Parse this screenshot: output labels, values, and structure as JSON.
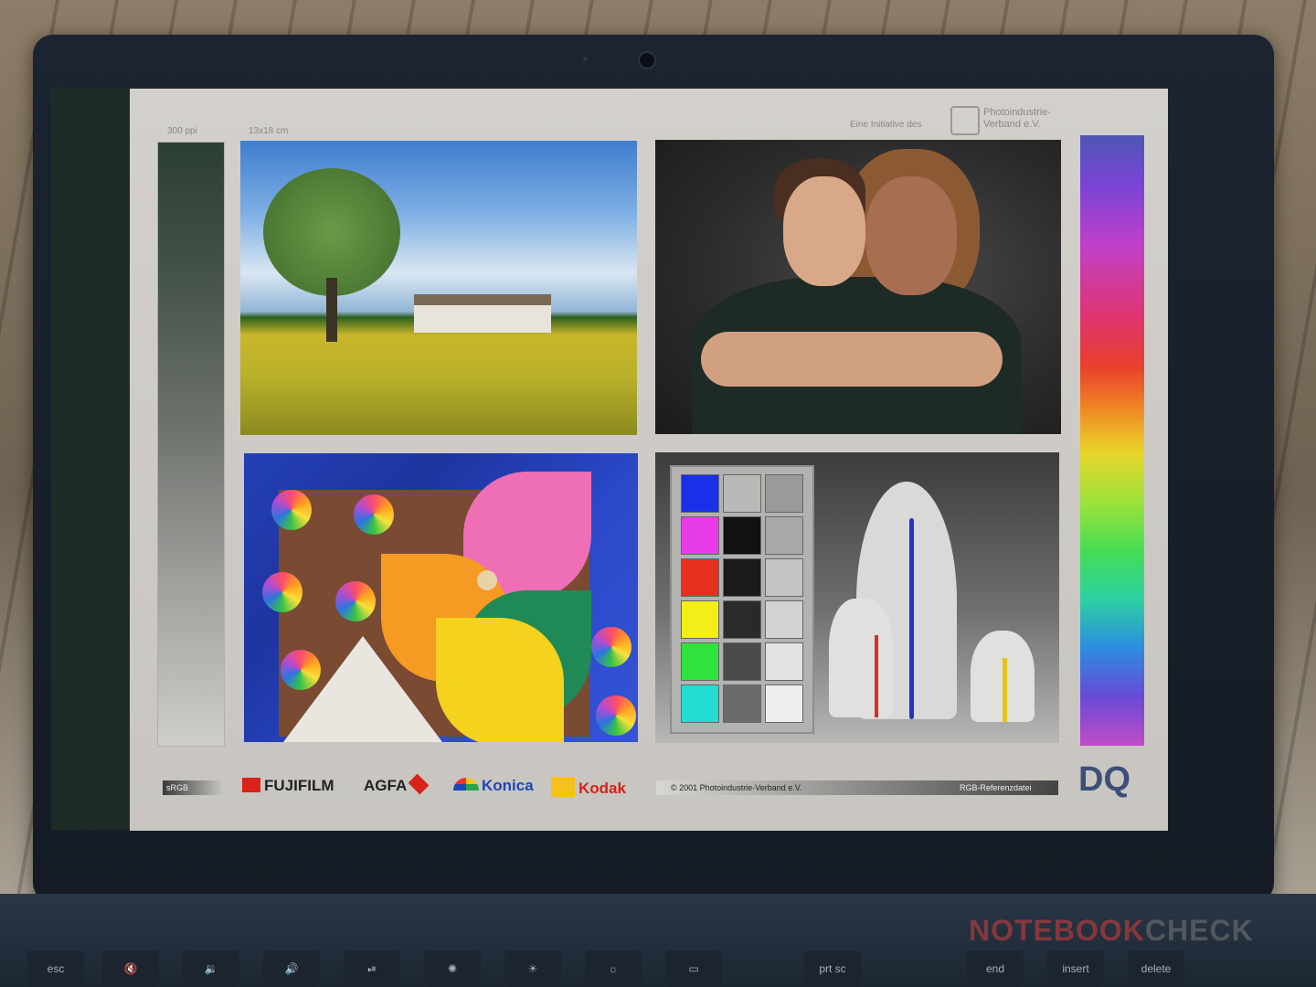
{
  "chart_header": {
    "resolution": "300 ppi",
    "size": "13x18 cm",
    "initiative": "Eine Initiative des",
    "org_line1": "Photoindustrie-",
    "org_line2": "Verband e.V."
  },
  "footer": {
    "srgb": "sRGB",
    "fujifilm": "FUJIFILM",
    "agfa": "AGFA",
    "konica": "Konica",
    "kodak": "Kodak",
    "copyright": "© 2001  Photoindustrie-Verband e.V.",
    "reference": "RGB-Referenzdatei",
    "dq_logo": "DQ"
  },
  "keyboard": {
    "keys": [
      "esc",
      "",
      "",
      "",
      "",
      "",
      "",
      "",
      "prt sc",
      "end",
      "insert",
      "delete"
    ]
  },
  "watermark": {
    "brand_a": "NOTEBOOK",
    "brand_b": "CHECK"
  },
  "colors": {
    "swatches": [
      "#1a2fe8",
      "#e83ce8",
      "#e8301e",
      "#f3ee1a",
      "#2ee33c",
      "#23dcd4"
    ]
  }
}
